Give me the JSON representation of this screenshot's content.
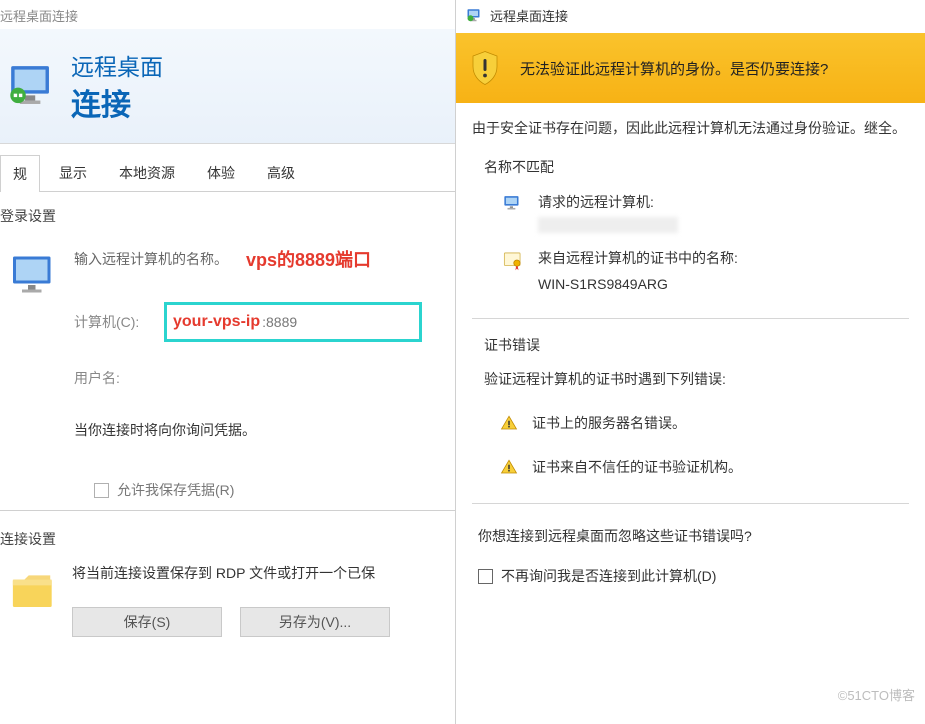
{
  "left": {
    "window_title": "远程桌面连接",
    "header_line1": "远程桌面",
    "header_line2": "连接",
    "tabs": [
      "规",
      "显示",
      "本地资源",
      "体验",
      "高级"
    ],
    "login_section_title": "登录设置",
    "enter_name_prompt": "输入远程计算机的名称。",
    "annotation_port": "vps的8889端口",
    "computer_label": "计算机(C):",
    "computer_annotation": "your-vps-ip",
    "computer_port": ":8889",
    "username_label": "用户名:",
    "cred_prompt": "当你连接时将向你询问凭据。",
    "save_cred_checkbox": "允许我保存凭据(R)",
    "conn_section_title": "连接设置",
    "conn_text": "将当前连接设置保存到 RDP 文件或打开一个已保",
    "save_btn": "保存(S)",
    "saveas_btn": "另存为(V)..."
  },
  "right": {
    "title": "远程桌面连接",
    "warn_text": "无法验证此远程计算机的身份。是否仍要连接?",
    "desc": "由于安全证书存在问题，因此此远程计算机无法通过身份验证。继全。",
    "name_mismatch": "名称不匹配",
    "requested_label": "请求的远程计算机:",
    "cert_name_label": "来自远程计算机的证书中的名称:",
    "cert_name_value": "WIN-S1RS9849ARG",
    "cert_error_title": "证书错误",
    "cert_error_desc": "验证远程计算机的证书时遇到下列错误:",
    "err1": "证书上的服务器名错误。",
    "err2": "证书来自不信任的证书验证机构。",
    "connect_q": "你想连接到远程桌面而忽略这些证书错误吗?",
    "dont_ask": "不再询问我是否连接到此计算机(D)"
  },
  "watermark": "©51CTO博客"
}
